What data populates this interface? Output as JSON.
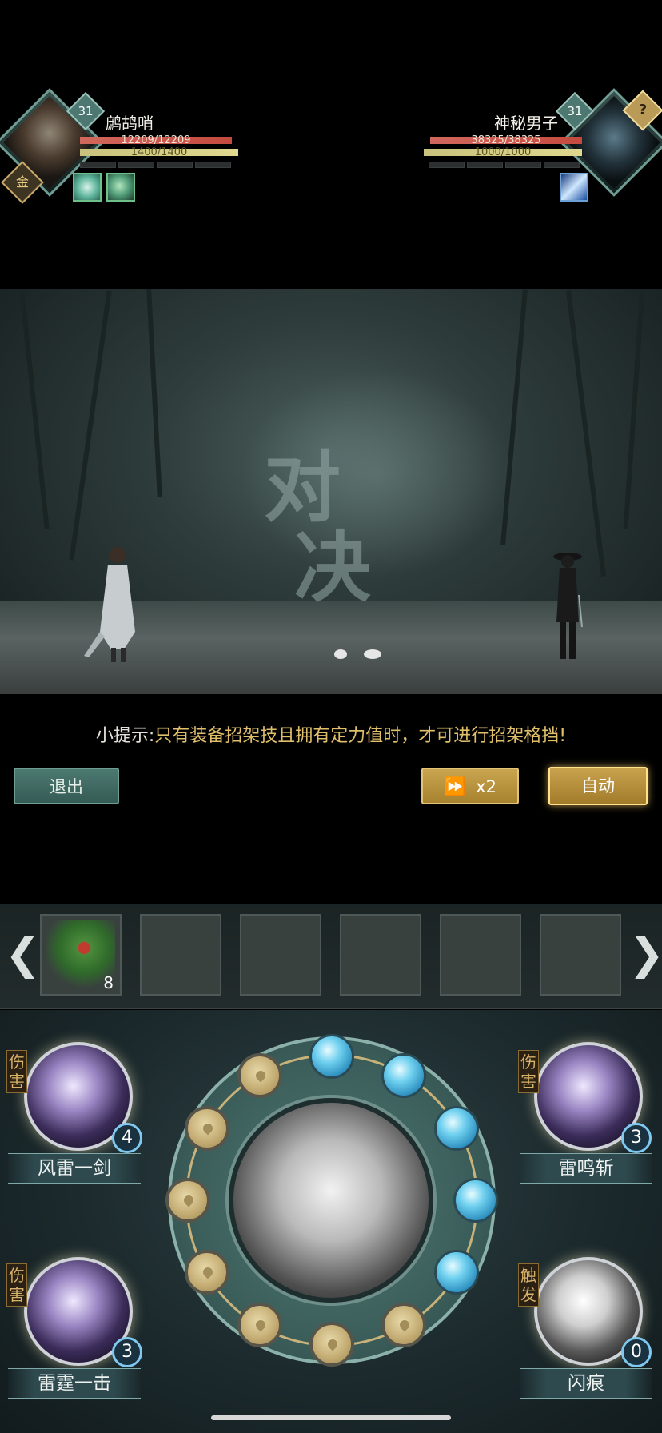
{
  "player": {
    "name": "鹧鸪哨",
    "level": "31",
    "hp": "12209/12209",
    "mp": "1400/1400",
    "rank_badge": "金",
    "buffs": [
      "lotus-buff-icon",
      "jade-buff-icon"
    ]
  },
  "enemy": {
    "name": "神秘男子",
    "level": "31",
    "hp": "38325/38325",
    "mp": "1000/1000",
    "unknown_badge": "?",
    "buffs": [
      "blade-buff-icon"
    ]
  },
  "scene": {
    "banner_text_1": "对",
    "banner_text_2": "决"
  },
  "tip": {
    "label": "小提示:",
    "text": "只有装备招架技且拥有定力值时，才可进行招架格挡!"
  },
  "buttons": {
    "exit": "退出",
    "speed": "x2",
    "auto": "自动"
  },
  "items": {
    "slots": [
      {
        "icon": "herb-icon",
        "count": "8"
      },
      {
        "icon": "",
        "count": ""
      },
      {
        "icon": "",
        "count": ""
      },
      {
        "icon": "",
        "count": ""
      },
      {
        "icon": "",
        "count": ""
      },
      {
        "icon": "",
        "count": ""
      }
    ]
  },
  "skills": {
    "left_top": {
      "tag": "伤害",
      "name": "风雷一剑",
      "count": "4"
    },
    "left_bottom": {
      "tag": "伤害",
      "name": "雷霆一击",
      "count": "3"
    },
    "right_top": {
      "tag": "伤害",
      "name": "雷鸣斩",
      "count": "3"
    },
    "right_bottom": {
      "tag": "触发",
      "name": "闪痕",
      "count": "0"
    }
  },
  "energy_wheel": {
    "filled_orbs": 5,
    "empty_orbs": 7
  },
  "colors": {
    "accent_gold": "#c9a550",
    "accent_teal": "#4c7971",
    "hp": "#c44a3e",
    "mp": "#e0d88f"
  }
}
